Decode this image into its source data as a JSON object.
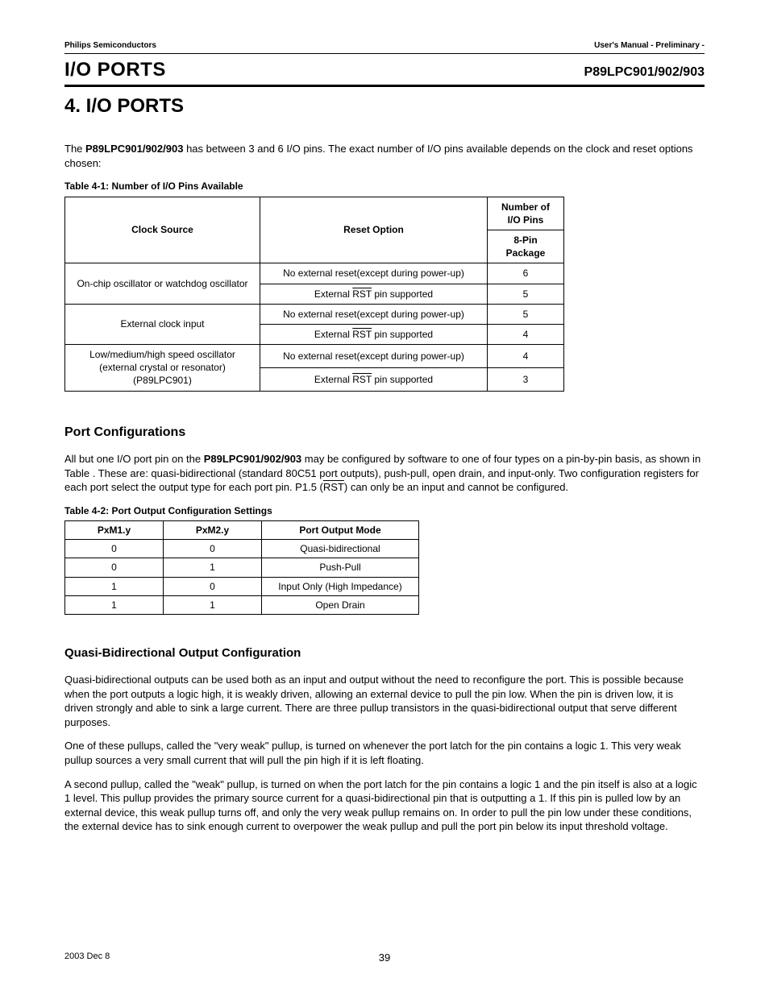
{
  "header": {
    "left": "Philips Semiconductors",
    "right": "User's Manual - Preliminary -",
    "section_left": "I/O PORTS",
    "section_right": "P89LPC901/902/903"
  },
  "chapter_title": "4. I/O PORTS",
  "intro": {
    "pre": "The ",
    "bold": "P89LPC901/902/903",
    "post": " has between 3 and 6 I/O pins. The exact number of I/O pins available depends on the clock and reset options chosen:"
  },
  "table1": {
    "caption": "Table 4-1: Number of I/O Pins Available",
    "h_clock": "Clock Source",
    "h_reset": "Reset Option",
    "h_num": "Number of I/O Pins",
    "h_pkg": "8-Pin Package",
    "rows": [
      {
        "clock": "On-chip oscillator or watchdog oscillator",
        "reset": "No external reset(except during power-up)",
        "pins": "6"
      },
      {
        "reset_pre": "External ",
        "reset_over": "RST",
        "reset_post": " pin supported",
        "pins": "5"
      },
      {
        "clock": "External clock input",
        "reset": "No external reset(except during power-up)",
        "pins": "5"
      },
      {
        "reset_pre": "External ",
        "reset_over": "RST",
        "reset_post": " pin supported",
        "pins": "4"
      },
      {
        "clock": "Low/medium/high speed oscillator (external crystal or resonator) (P89LPC901)",
        "reset": "No external reset(except during power-up)",
        "pins": "4"
      },
      {
        "reset_pre": "External ",
        "reset_over": "RST",
        "reset_post": " pin supported",
        "pins": "3"
      }
    ]
  },
  "port_config": {
    "title": "Port Configurations",
    "p_pre": "All but one I/O port pin on the ",
    "p_bold": "P89LPC901/902/903",
    "p_mid": " may be configured by software to one of four types on a pin-by-pin basis, as shown in Table . These are: quasi-bidirectional (standard 80C51 port outputs), push-pull, open drain, and input-only. Two configuration registers for each port select the output type for each port pin. P1.5 (",
    "p_over": "RST",
    "p_post": ") can only be an input and cannot be configured."
  },
  "table2": {
    "caption": "Table 4-2:  Port Output Configuration Settings",
    "h1": "PxM1.y",
    "h2": "PxM2.y",
    "h3": "Port Output Mode",
    "rows": [
      {
        "a": "0",
        "b": "0",
        "m": "Quasi-bidirectional"
      },
      {
        "a": "0",
        "b": "1",
        "m": "Push-Pull"
      },
      {
        "a": "1",
        "b": "0",
        "m": "Input Only (High Impedance)"
      },
      {
        "a": "1",
        "b": "1",
        "m": "Open Drain"
      }
    ]
  },
  "quasi": {
    "title": "Quasi-Bidirectional Output Configuration",
    "p1": "Quasi-bidirectional outputs can be used both as an input and output without the need to reconfigure the port. This is possible because when the port outputs a logic high, it is weakly driven, allowing an external device to pull the pin low. When the pin is driven low, it is driven strongly and able to sink a large current. There are three pullup transistors in the quasi-bidirectional output that serve different purposes.",
    "p2": "One of these pullups, called the \"very weak\" pullup, is turned on whenever the port latch for  the pin contains a logic 1. This very weak pullup sources a very small current that will pull the pin high if it is left floating.",
    "p3": "A second pullup, called the \"weak\" pullup, is turned on when the port latch for the pin contains a logic 1 and the pin itself is also at a logic 1 level. This pullup provides the primary source current for a quasi-bidirectional pin that is outputting a 1. If this pin is pulled low by an external device, this weak pullup turns off, and only the very weak pullup remains on. In order to pull the pin low under these conditions, the external device has to sink enough current to overpower the weak pullup and pull the port pin below its input threshold voltage."
  },
  "footer": {
    "date": "2003 Dec 8",
    "page": "39"
  }
}
